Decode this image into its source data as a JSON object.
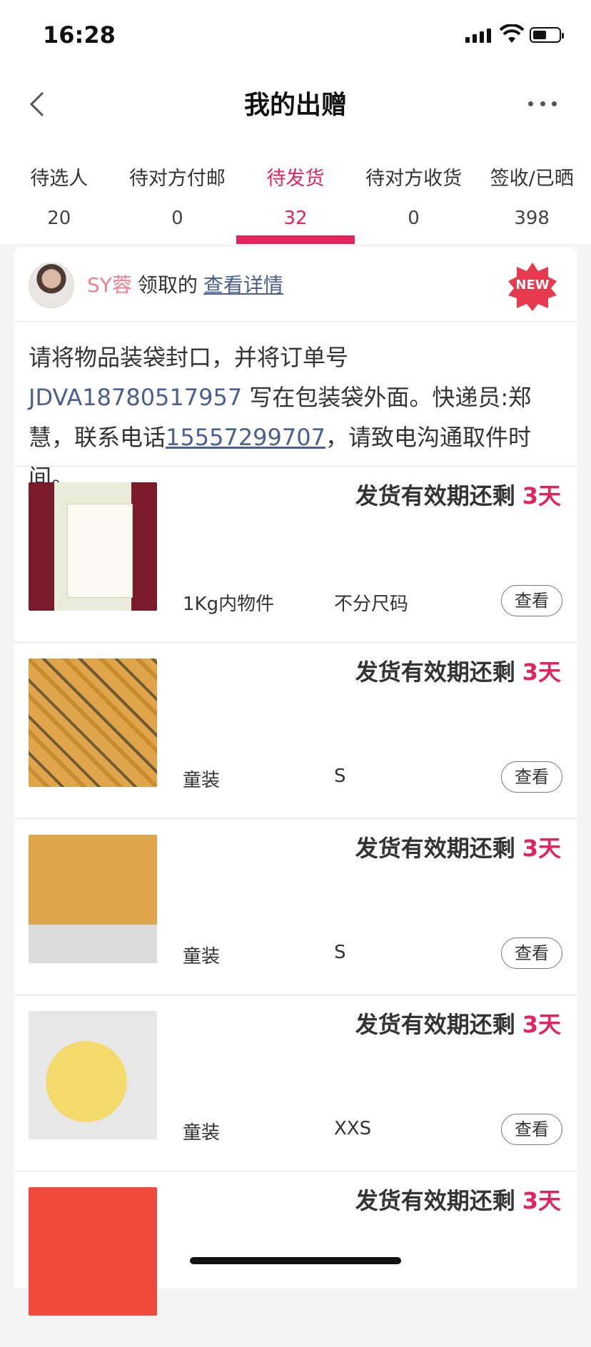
{
  "status": {
    "time": "16:28"
  },
  "header": {
    "title": "我的出赠"
  },
  "tabs": [
    {
      "label": "待选人",
      "count": "20"
    },
    {
      "label": "待对方付邮",
      "count": "0"
    },
    {
      "label": "待发货",
      "count": "32"
    },
    {
      "label": "待对方收货",
      "count": "0"
    },
    {
      "label": "签收/已晒",
      "count": "398"
    }
  ],
  "card": {
    "user": "SY蓉",
    "claimed_text": "领取的",
    "detail_link": "查看详情",
    "badge": "NEW",
    "notice_part1": "请将物品装袋封口，并将订单号 ",
    "order_no": "JDVA18780517957",
    "notice_part2": " 写在包装袋外面。快递员:郑慧，联系电话",
    "phone": "15557299707",
    "notice_part3": "，请致电沟通取件时间。"
  },
  "items": [
    {
      "deadline_label": "发货有效期还剩",
      "days": "3天",
      "category": "1Kg内物件",
      "size": "不分尺码",
      "button": "查看"
    },
    {
      "deadline_label": "发货有效期还剩",
      "days": "3天",
      "category": "童装",
      "size": "S",
      "button": "查看"
    },
    {
      "deadline_label": "发货有效期还剩",
      "days": "3天",
      "category": "童装",
      "size": "S",
      "button": "查看"
    },
    {
      "deadline_label": "发货有效期还剩",
      "days": "3天",
      "category": "童装",
      "size": "XXS",
      "button": "查看"
    },
    {
      "deadline_label": "发货有效期还剩",
      "days": "3天",
      "category": "",
      "size": "",
      "button": ""
    }
  ],
  "colors": {
    "accent": "#e0245e",
    "link": "#4a5f8f",
    "username": "#f07f8f"
  }
}
